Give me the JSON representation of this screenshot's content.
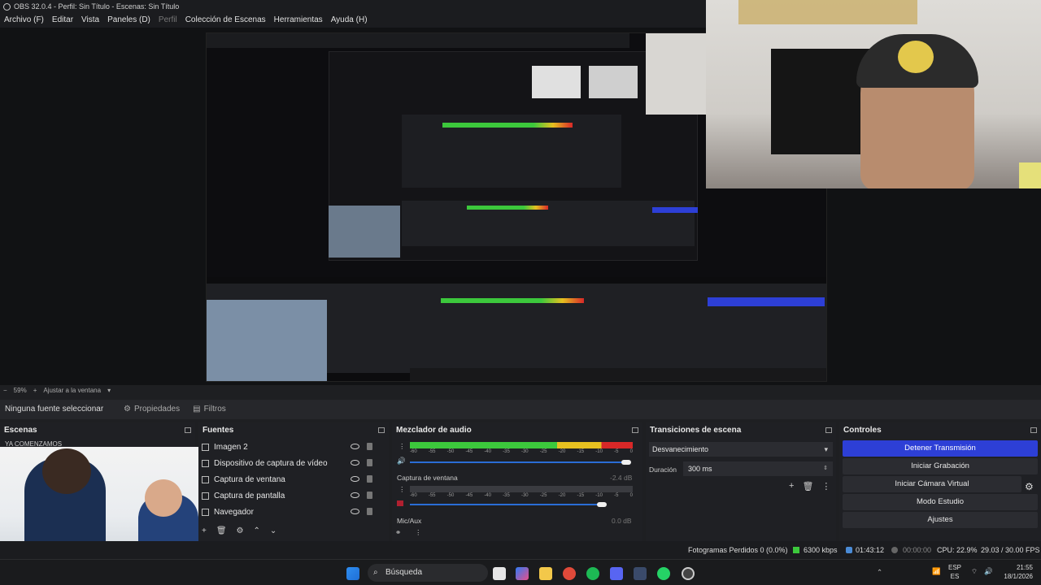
{
  "window": {
    "title": "OBS 32.0.4 - Perfil: Sin Título - Escenas: Sin Título"
  },
  "menu": {
    "items": [
      "Archivo (F)",
      "Editar",
      "Vista",
      "Paneles (D)",
      "Perfil",
      "Colección de Escenas",
      "Herramientas",
      "Ayuda (H)"
    ]
  },
  "preview": {
    "zoom": "59%",
    "fit_label": "Ajustar a la ventana"
  },
  "source_toolbar": {
    "no_source": "Ninguna fuente seleccionar",
    "properties": "Propiedades",
    "filters": "Filtros"
  },
  "scenes": {
    "title": "Escenas",
    "item": "YA COMENZAMOS"
  },
  "sources": {
    "title": "Fuentes",
    "items": [
      "Imagen 2",
      "Dispositivo de captura de vídeo",
      "Captura de ventana",
      "Captura de pantalla",
      "Navegador"
    ]
  },
  "mixer": {
    "title": "Mezclador de audio",
    "channels": [
      {
        "name": "",
        "db": ""
      },
      {
        "name": "Captura de ventana",
        "db": "-2.4 dB"
      },
      {
        "name": "Mic/Aux",
        "db": "0.0 dB"
      }
    ],
    "ticks": [
      "-60",
      "-55",
      "-50",
      "-45",
      "-40",
      "-35",
      "-30",
      "-25",
      "-20",
      "-15",
      "-10",
      "-5",
      "0"
    ]
  },
  "transitions": {
    "title": "Transiciones de escena",
    "selected": "Desvanecimiento",
    "duration_label": "Duración",
    "duration_value": "300 ms"
  },
  "controls": {
    "title": "Controles",
    "buttons": [
      "Detener Transmisión",
      "Iniciar Grabación",
      "Iniciar Cámara Virtual",
      "Modo Estudio",
      "Ajustes"
    ]
  },
  "status": {
    "dropped": "Fotogramas Perdidos 0 (0.0%)",
    "bitrate": "6300 kbps",
    "stream_time": "01:43:12",
    "rec_time": "00:00:00",
    "cpu": "CPU: 22.9%",
    "fps": "29.03 / 30.00 FPS"
  },
  "taskbar": {
    "search": "Búsqueda",
    "lang": "ESP",
    "region": "ES",
    "time": "21:55",
    "date": "18/1/2026"
  },
  "colors": {
    "accent": "#2d3fd6",
    "meter_green": "#3cc83c",
    "meter_yellow": "#e6c020",
    "meter_red": "#d82828"
  }
}
